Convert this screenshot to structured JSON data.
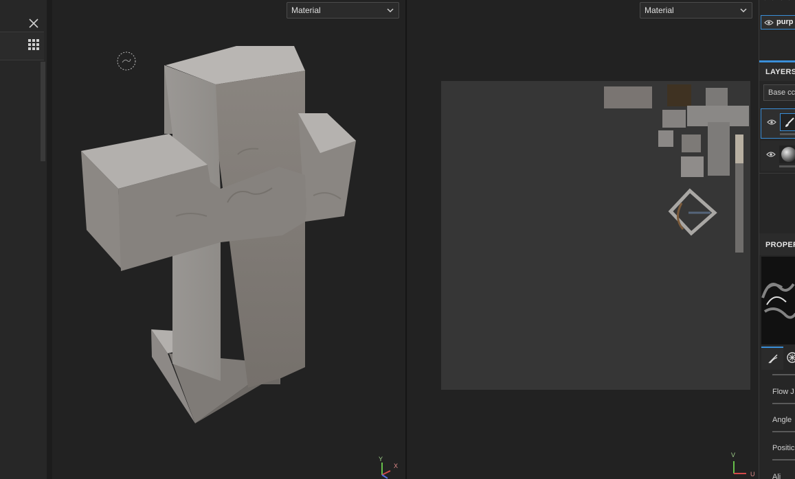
{
  "left_panel": {
    "close_label": "✕",
    "grid_label": "grid-icon"
  },
  "viewport3d": {
    "mode_label": "Material",
    "axis_y": "Y",
    "axis_x": "X"
  },
  "viewport2d": {
    "mode_label": "Material",
    "axis_v": "V",
    "axis_u": "U"
  },
  "right_panel": {
    "texture_set_name": "purp",
    "layers_title": "LAYERS",
    "blend_mode_value": "Base cc",
    "properties_title": "PROPERT",
    "params": [
      "Flow J",
      "Angle",
      "Positic",
      "Ali"
    ],
    "accent_color": "#3a8fd9"
  }
}
